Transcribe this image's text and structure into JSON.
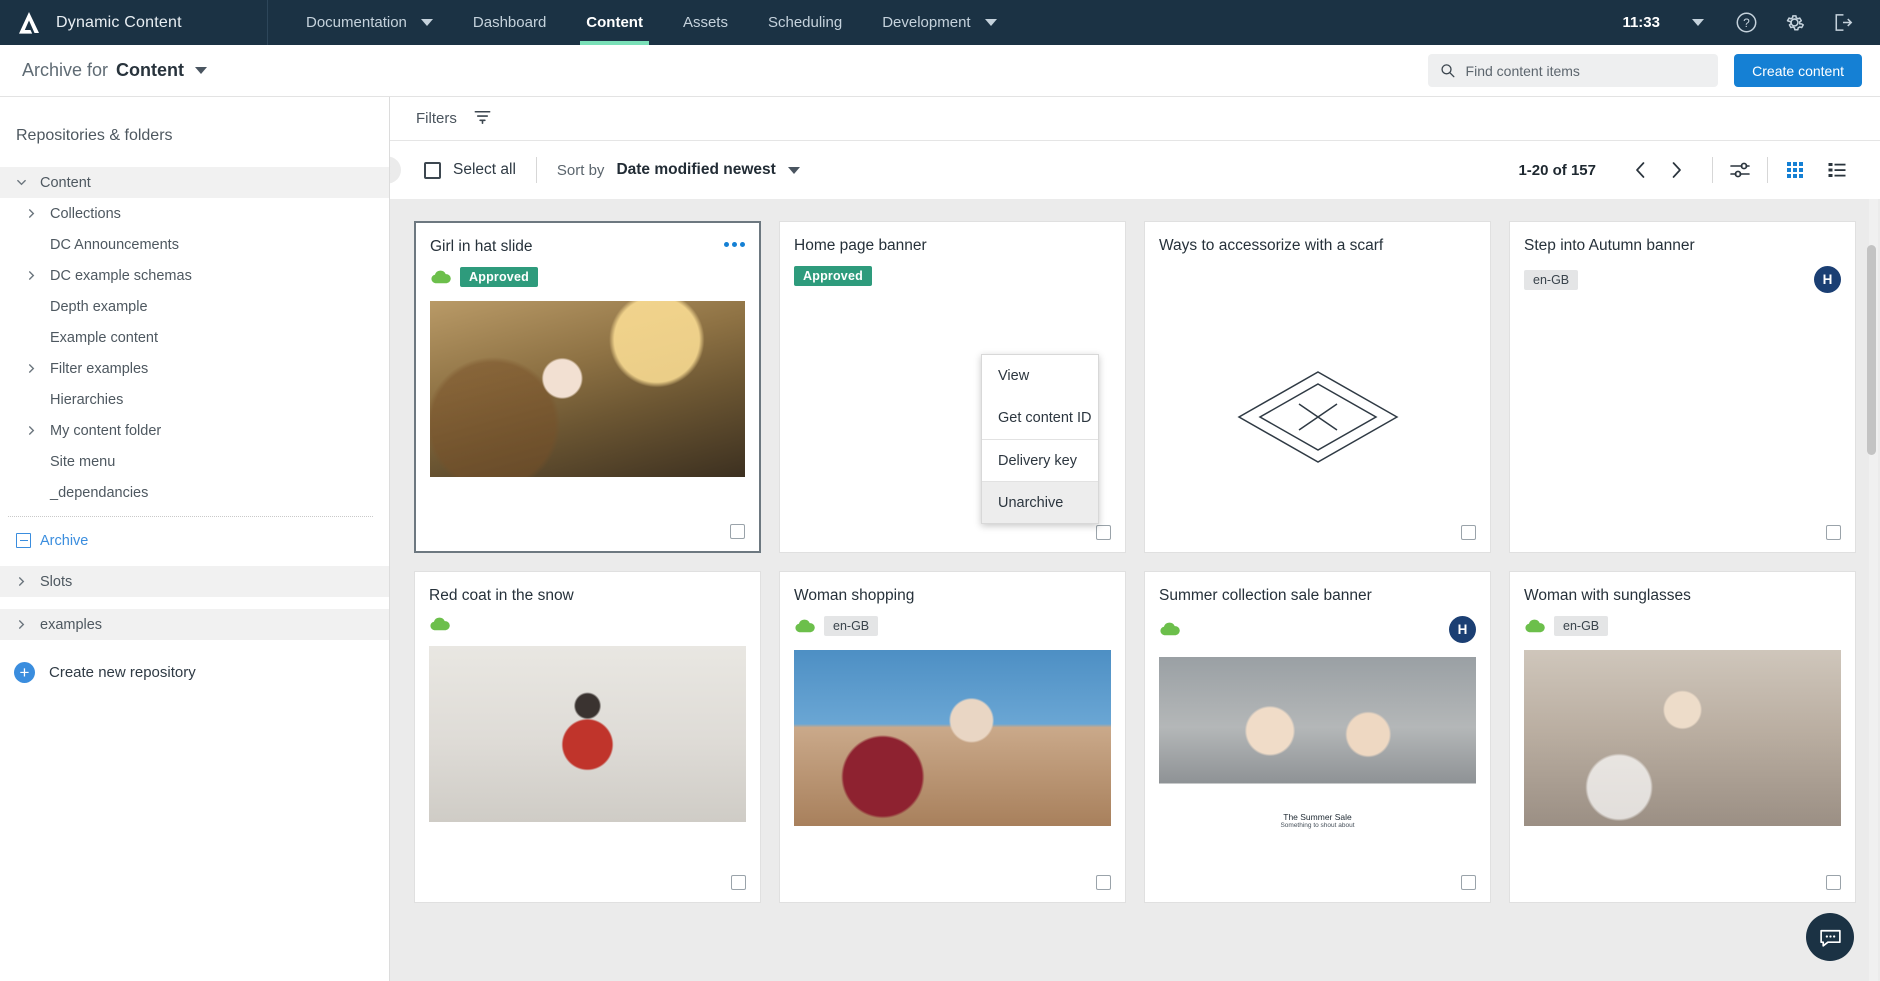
{
  "topnav": {
    "brand": "Dynamic Content",
    "items": [
      {
        "label": "Documentation",
        "has_caret": true,
        "active": false
      },
      {
        "label": "Dashboard",
        "has_caret": false,
        "active": false
      },
      {
        "label": "Content",
        "has_caret": false,
        "active": true
      },
      {
        "label": "Assets",
        "has_caret": false,
        "active": false
      },
      {
        "label": "Scheduling",
        "has_caret": false,
        "active": false
      },
      {
        "label": "Development",
        "has_caret": true,
        "active": false
      }
    ],
    "clock": "11:33",
    "icons": [
      "help-icon",
      "gear-icon",
      "logout-icon"
    ]
  },
  "subheader": {
    "title_prefix": "Archive for",
    "title_target": "Content",
    "search_placeholder": "Find content items",
    "search_value": "",
    "create_button": "Create content"
  },
  "sidebar": {
    "heading": "Repositories & folders",
    "tree": [
      {
        "label": "Content",
        "chevron": "down",
        "indent": 0,
        "selected": true,
        "style": "normal"
      },
      {
        "label": "Collections",
        "chevron": "right",
        "indent": 1,
        "selected": false,
        "style": "normal"
      },
      {
        "label": "DC Announcements",
        "chevron": "none",
        "indent": 1,
        "selected": false,
        "style": "normal"
      },
      {
        "label": "DC example schemas",
        "chevron": "right",
        "indent": 1,
        "selected": false,
        "style": "normal"
      },
      {
        "label": "Depth example",
        "chevron": "none",
        "indent": 1,
        "selected": false,
        "style": "normal"
      },
      {
        "label": "Example content",
        "chevron": "none",
        "indent": 1,
        "selected": false,
        "style": "normal"
      },
      {
        "label": "Filter examples",
        "chevron": "right",
        "indent": 1,
        "selected": false,
        "style": "normal"
      },
      {
        "label": "Hierarchies",
        "chevron": "none",
        "indent": 1,
        "selected": false,
        "style": "normal"
      },
      {
        "label": "My content folder",
        "chevron": "right",
        "indent": 1,
        "selected": false,
        "style": "normal"
      },
      {
        "label": "Site menu",
        "chevron": "none",
        "indent": 1,
        "selected": false,
        "style": "normal"
      },
      {
        "label": "_dependancies",
        "chevron": "none",
        "indent": 1,
        "selected": false,
        "style": "normal"
      }
    ],
    "archive": {
      "label": "Archive",
      "icon": "archive-box-icon"
    },
    "repos": [
      {
        "label": "Slots",
        "chevron": "right"
      },
      {
        "label": "examples",
        "chevron": "right"
      }
    ],
    "create_repository": "Create new repository"
  },
  "toolbar": {
    "filters_label": "Filters",
    "filter_icon": "filter-icon",
    "collapse_icon": "chevron-left-icon",
    "select_all_label": "Select all",
    "select_all_checked": false,
    "sort_by_label": "Sort by",
    "sort_by_value": "Date modified newest",
    "pagination_count": "1-20 of 157",
    "prev_icon": "chevron-left-icon",
    "next_icon": "chevron-right-icon",
    "settings_icon": "sliders-icon",
    "grid_view_icon": "grid-view-icon",
    "list_view_icon": "list-view-icon",
    "active_view": "grid"
  },
  "context_menu": {
    "items": [
      {
        "label": "View",
        "highlighted": false,
        "separator_above": false
      },
      {
        "label": "Get content ID",
        "highlighted": false,
        "separator_above": false
      },
      {
        "label": "Delivery key",
        "highlighted": false,
        "separator_above": true
      },
      {
        "label": "Unarchive",
        "highlighted": true,
        "separator_above": true
      }
    ]
  },
  "cards": [
    {
      "title": "Girl in hat slide",
      "status_icon": "cloud-icon",
      "badge": "Approved",
      "badge_type": "approved",
      "locale": "",
      "avatar": "",
      "thumb_class": "ph-girl-hat",
      "focused": true,
      "menu_open": true,
      "has_thumb": true
    },
    {
      "title": "Home page banner",
      "status_icon": "cloud-icon",
      "badge": "Approved",
      "badge_type": "approved",
      "locale": "",
      "avatar": "",
      "thumb_class": "",
      "focused": false,
      "menu_open": false,
      "has_thumb": false
    },
    {
      "title": "Ways to accessorize with a scarf",
      "status_icon": "",
      "badge": "",
      "badge_type": "none",
      "locale": "",
      "avatar": "",
      "thumb_class": "iso",
      "focused": false,
      "menu_open": false,
      "has_thumb": false
    },
    {
      "title": "Step into Autumn banner",
      "status_icon": "",
      "badge": "en-GB",
      "badge_type": "locale",
      "locale": "en-GB",
      "avatar": "H",
      "thumb_class": "",
      "focused": false,
      "menu_open": false,
      "has_thumb": false
    },
    {
      "title": "Red coat in the snow",
      "status_icon": "cloud-icon",
      "badge": "",
      "badge_type": "none",
      "locale": "",
      "avatar": "",
      "thumb_class": "ph-red-coat",
      "focused": false,
      "menu_open": false,
      "has_thumb": true
    },
    {
      "title": "Woman shopping",
      "status_icon": "cloud-icon",
      "badge": "en-GB",
      "badge_type": "locale",
      "locale": "en-GB",
      "avatar": "",
      "thumb_class": "ph-shopping",
      "focused": false,
      "menu_open": false,
      "has_thumb": true
    },
    {
      "title": "Summer collection sale banner",
      "status_icon": "cloud-icon",
      "badge": "",
      "badge_type": "none",
      "locale": "",
      "avatar": "H",
      "thumb_class": "ph-summer",
      "focused": false,
      "menu_open": false,
      "has_thumb": true,
      "thumb_caption_1": "The Summer Sale",
      "thumb_caption_2": "Something to shout about"
    },
    {
      "title": "Woman with sunglasses",
      "status_icon": "cloud-icon",
      "badge": "en-GB",
      "badge_type": "locale",
      "locale": "en-GB",
      "avatar": "",
      "thumb_class": "ph-sunglasses",
      "focused": false,
      "menu_open": false,
      "has_thumb": true
    }
  ],
  "chat": {
    "icon": "chat-bubble-icon"
  },
  "colors": {
    "navbar": "#1b3244",
    "accent_green": "#7ae0b8",
    "primary_blue": "#1580d4",
    "approved_green": "#2e9b7c",
    "link_blue": "#3a8dde"
  }
}
